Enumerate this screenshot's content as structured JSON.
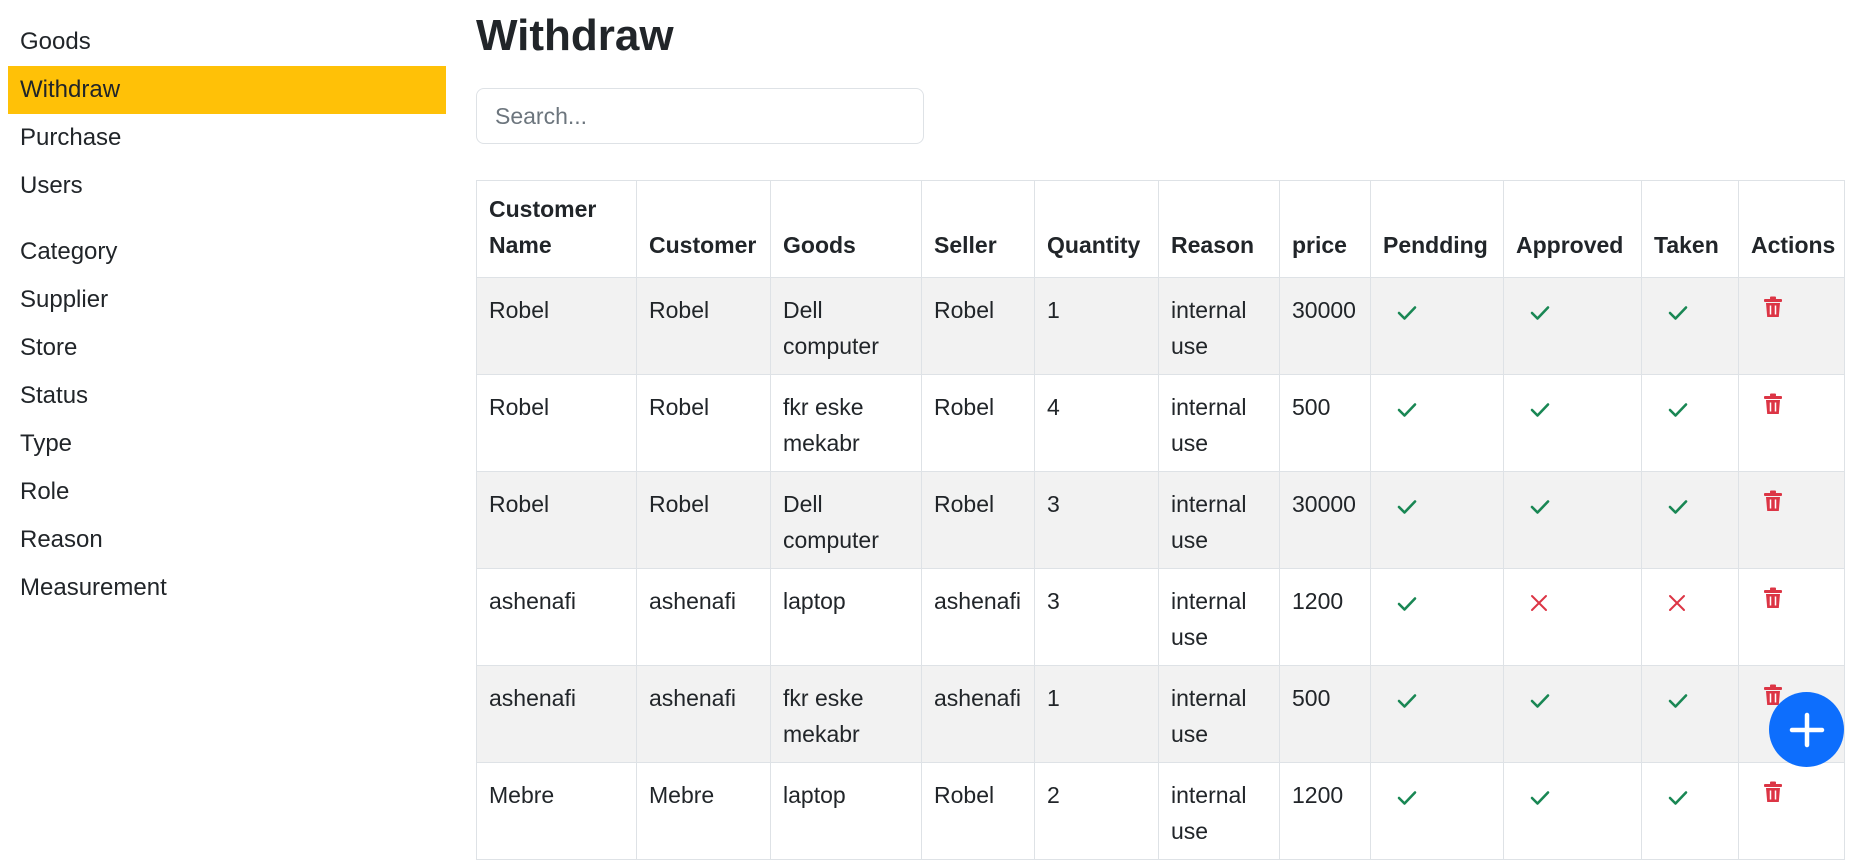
{
  "sidebar": {
    "items": [
      {
        "label": "Goods",
        "active": false
      },
      {
        "label": "Withdraw",
        "active": true
      },
      {
        "label": "Purchase",
        "active": false
      },
      {
        "label": "Users",
        "active": false
      },
      {
        "label": "Category",
        "active": false
      },
      {
        "label": "Supplier",
        "active": false
      },
      {
        "label": "Store",
        "active": false
      },
      {
        "label": "Status",
        "active": false
      },
      {
        "label": "Type",
        "active": false
      },
      {
        "label": "Role",
        "active": false
      },
      {
        "label": "Reason",
        "active": false
      },
      {
        "label": "Measurement",
        "active": false
      }
    ]
  },
  "main": {
    "title": "Withdraw",
    "search": {
      "placeholder": "Search...",
      "value": ""
    }
  },
  "table": {
    "headers": [
      "Customer Name",
      "Customer",
      "Goods",
      "Seller",
      "Quantity",
      "Reason",
      "price",
      "Pendding",
      "Approved",
      "Taken",
      "Actions"
    ],
    "rows": [
      {
        "customer_name": "Robel",
        "customer": "Robel",
        "goods": "Dell computer",
        "seller": "Robel",
        "quantity": "1",
        "reason": "internal use",
        "price": "30000",
        "pending": true,
        "approved": true,
        "taken": true
      },
      {
        "customer_name": "Robel",
        "customer": "Robel",
        "goods": "fkr eske mekabr",
        "seller": "Robel",
        "quantity": "4",
        "reason": "internal use",
        "price": "500",
        "pending": true,
        "approved": true,
        "taken": true
      },
      {
        "customer_name": "Robel",
        "customer": "Robel",
        "goods": "Dell computer",
        "seller": "Robel",
        "quantity": "3",
        "reason": "internal use",
        "price": "30000",
        "pending": true,
        "approved": true,
        "taken": true
      },
      {
        "customer_name": "ashenafi",
        "customer": "ashenafi",
        "goods": "laptop",
        "seller": "ashenafi",
        "quantity": "3",
        "reason": "internal use",
        "price": "1200",
        "pending": true,
        "approved": false,
        "taken": false
      },
      {
        "customer_name": "ashenafi",
        "customer": "ashenafi",
        "goods": "fkr eske mekabr",
        "seller": "ashenafi",
        "quantity": "1",
        "reason": "internal use",
        "price": "500",
        "pending": true,
        "approved": true,
        "taken": true
      },
      {
        "customer_name": "Mebre",
        "customer": "Mebre",
        "goods": "laptop",
        "seller": "Robel",
        "quantity": "2",
        "reason": "internal use",
        "price": "1200",
        "pending": true,
        "approved": true,
        "taken": true
      }
    ]
  },
  "icons": {
    "check": "check-icon",
    "cross": "cross-icon",
    "delete": "trash-icon",
    "add": "plus-icon"
  },
  "colors": {
    "active_nav": "#ffc107",
    "success": "#198754",
    "danger": "#dc3545",
    "primary": "#0d6efd",
    "stripe": "#f2f2f2"
  }
}
